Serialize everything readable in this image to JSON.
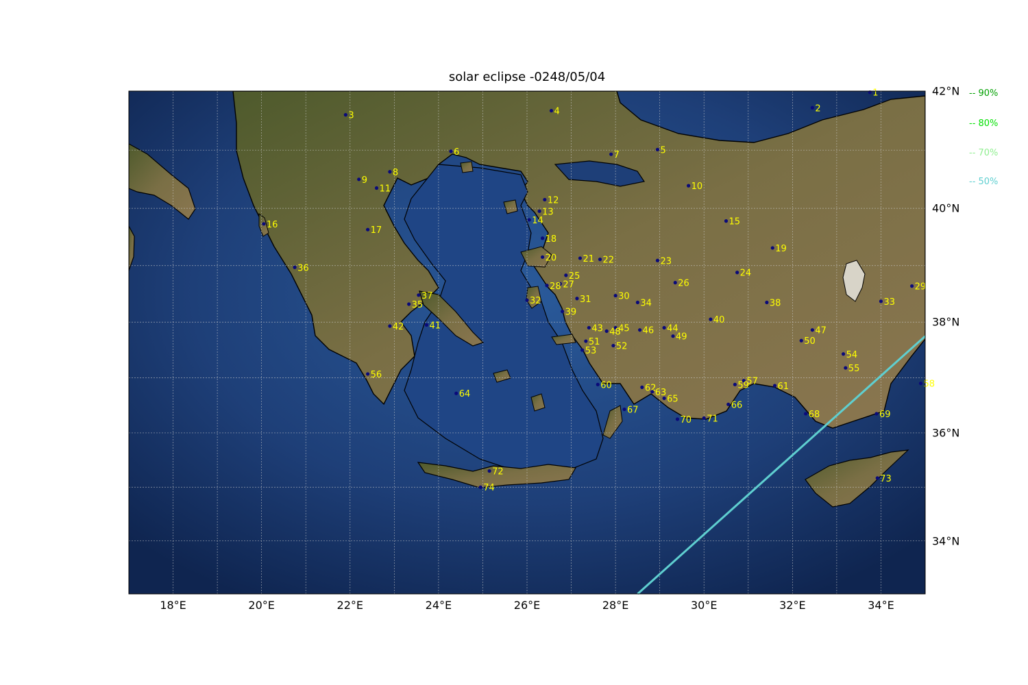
{
  "title": "solar eclipse -0248/05/04",
  "map": {
    "lon_range": [
      17,
      35
    ],
    "lat_range": [
      33,
      42
    ],
    "x_ticks": [
      "18°E",
      "20°E",
      "22°E",
      "24°E",
      "26°E",
      "28°E",
      "30°E",
      "32°E",
      "34°E"
    ],
    "y_ticks": [
      "34°N",
      "36°N",
      "38°N",
      "40°N",
      "42°N"
    ],
    "colors": {
      "sea": "#1e3f78",
      "land": "#6b6a3e",
      "grid": "#cfcfcf",
      "coast": "#000000",
      "point": "#0a0a7a",
      "label": "#ffff00",
      "path": "#5fcfd0"
    }
  },
  "legend": [
    {
      "label": "-- 90%",
      "color": "#00a000"
    },
    {
      "label": "-- 80%",
      "color": "#00e000"
    },
    {
      "label": "-- 70%",
      "color": "#90ee90"
    },
    {
      "label": "-- 50%",
      "color": "#5fcfd0"
    }
  ],
  "eclipse_path_50": [
    [
      28.5,
      33.0
    ],
    [
      35.0,
      37.75
    ]
  ],
  "locations": [
    {
      "id": "1",
      "lon": 33.75,
      "lat": 41.98
    },
    {
      "id": "2",
      "lon": 32.45,
      "lat": 41.72
    },
    {
      "id": "3",
      "lon": 21.9,
      "lat": 41.6
    },
    {
      "id": "4",
      "lon": 26.55,
      "lat": 41.67
    },
    {
      "id": "5",
      "lon": 28.95,
      "lat": 41.01
    },
    {
      "id": "6",
      "lon": 24.28,
      "lat": 40.98
    },
    {
      "id": "7",
      "lon": 27.9,
      "lat": 40.93
    },
    {
      "id": "8",
      "lon": 22.9,
      "lat": 40.63
    },
    {
      "id": "9",
      "lon": 22.2,
      "lat": 40.5
    },
    {
      "id": "10",
      "lon": 29.65,
      "lat": 40.39
    },
    {
      "id": "11",
      "lon": 22.6,
      "lat": 40.35
    },
    {
      "id": "12",
      "lon": 26.4,
      "lat": 40.15
    },
    {
      "id": "13",
      "lon": 26.28,
      "lat": 39.95
    },
    {
      "id": "14",
      "lon": 26.05,
      "lat": 39.8
    },
    {
      "id": "15",
      "lon": 30.5,
      "lat": 39.78
    },
    {
      "id": "16",
      "lon": 20.05,
      "lat": 39.73
    },
    {
      "id": "17",
      "lon": 22.4,
      "lat": 39.63
    },
    {
      "id": "18",
      "lon": 26.35,
      "lat": 39.48
    },
    {
      "id": "19",
      "lon": 31.55,
      "lat": 39.31
    },
    {
      "id": "20",
      "lon": 26.35,
      "lat": 39.15
    },
    {
      "id": "21",
      "lon": 27.2,
      "lat": 39.13
    },
    {
      "id": "22",
      "lon": 27.65,
      "lat": 39.11
    },
    {
      "id": "23",
      "lon": 28.95,
      "lat": 39.09
    },
    {
      "id": "24",
      "lon": 30.75,
      "lat": 38.88
    },
    {
      "id": "25",
      "lon": 26.88,
      "lat": 38.83
    },
    {
      "id": "26",
      "lon": 29.35,
      "lat": 38.7
    },
    {
      "id": "27",
      "lon": 26.75,
      "lat": 38.68
    },
    {
      "id": "28",
      "lon": 26.45,
      "lat": 38.65
    },
    {
      "id": "29",
      "lon": 34.7,
      "lat": 38.64
    },
    {
      "id": "30",
      "lon": 28.0,
      "lat": 38.47
    },
    {
      "id": "31",
      "lon": 27.13,
      "lat": 38.42
    },
    {
      "id": "32",
      "lon": 26.0,
      "lat": 38.39
    },
    {
      "id": "33",
      "lon": 34.0,
      "lat": 38.37
    },
    {
      "id": "34",
      "lon": 28.5,
      "lat": 38.35
    },
    {
      "id": "35",
      "lon": 23.33,
      "lat": 38.32
    },
    {
      "id": "36",
      "lon": 20.75,
      "lat": 38.97
    },
    {
      "id": "37",
      "lon": 23.55,
      "lat": 38.48
    },
    {
      "id": "38",
      "lon": 31.42,
      "lat": 38.35
    },
    {
      "id": "39",
      "lon": 26.8,
      "lat": 38.19
    },
    {
      "id": "40",
      "lon": 30.15,
      "lat": 38.05
    },
    {
      "id": "41",
      "lon": 23.73,
      "lat": 37.95
    },
    {
      "id": "42",
      "lon": 22.9,
      "lat": 37.93
    },
    {
      "id": "43",
      "lon": 27.4,
      "lat": 37.9
    },
    {
      "id": "44",
      "lon": 29.1,
      "lat": 37.9
    },
    {
      "id": "45",
      "lon": 28.0,
      "lat": 37.9
    },
    {
      "id": "46",
      "lon": 28.55,
      "lat": 37.86
    },
    {
      "id": "47",
      "lon": 32.45,
      "lat": 37.86
    },
    {
      "id": "48",
      "lon": 27.8,
      "lat": 37.84
    },
    {
      "id": "49",
      "lon": 29.3,
      "lat": 37.75
    },
    {
      "id": "50",
      "lon": 32.2,
      "lat": 37.67
    },
    {
      "id": "51",
      "lon": 27.33,
      "lat": 37.66
    },
    {
      "id": "52",
      "lon": 27.95,
      "lat": 37.58
    },
    {
      "id": "53",
      "lon": 27.25,
      "lat": 37.5
    },
    {
      "id": "54",
      "lon": 33.15,
      "lat": 37.43
    },
    {
      "id": "55",
      "lon": 33.2,
      "lat": 37.18
    },
    {
      "id": "56",
      "lon": 22.4,
      "lat": 37.07
    },
    {
      "id": "57",
      "lon": 30.9,
      "lat": 36.95
    },
    {
      "id": "58",
      "lon": 34.9,
      "lat": 36.9
    },
    {
      "id": "59",
      "lon": 30.7,
      "lat": 36.88
    },
    {
      "id": "60",
      "lon": 27.6,
      "lat": 36.88
    },
    {
      "id": "61",
      "lon": 31.6,
      "lat": 36.86
    },
    {
      "id": "62",
      "lon": 28.6,
      "lat": 36.83
    },
    {
      "id": "63",
      "lon": 28.83,
      "lat": 36.75
    },
    {
      "id": "64",
      "lon": 24.4,
      "lat": 36.72
    },
    {
      "id": "65",
      "lon": 29.1,
      "lat": 36.63
    },
    {
      "id": "66",
      "lon": 30.55,
      "lat": 36.52
    },
    {
      "id": "67",
      "lon": 28.2,
      "lat": 36.43
    },
    {
      "id": "68",
      "lon": 32.3,
      "lat": 36.35
    },
    {
      "id": "69",
      "lon": 33.9,
      "lat": 36.35
    },
    {
      "id": "70",
      "lon": 29.4,
      "lat": 36.25
    },
    {
      "id": "71",
      "lon": 30.0,
      "lat": 36.27
    },
    {
      "id": "72",
      "lon": 25.15,
      "lat": 35.3
    },
    {
      "id": "73",
      "lon": 33.92,
      "lat": 35.17
    },
    {
      "id": "74",
      "lon": 24.95,
      "lat": 35.0
    }
  ]
}
